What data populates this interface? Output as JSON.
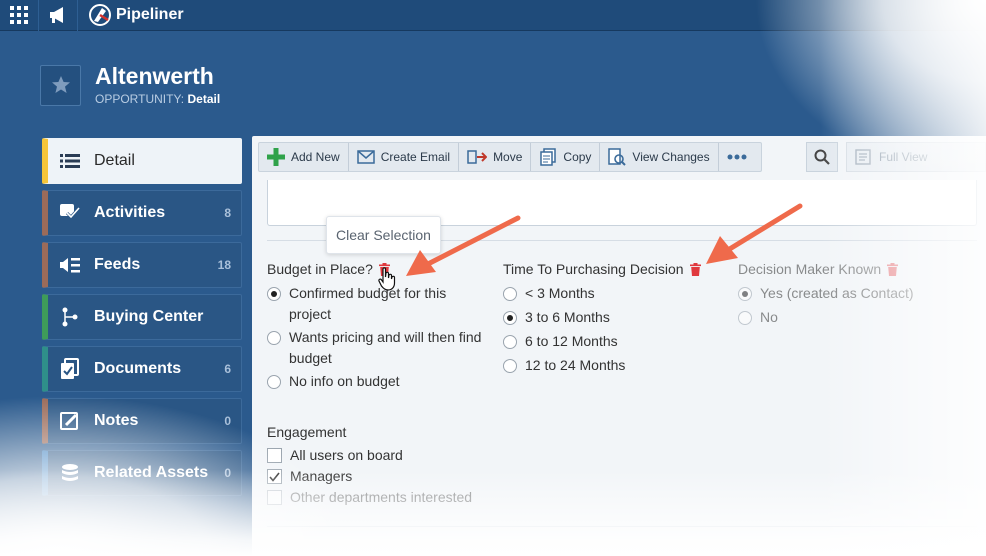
{
  "app": {
    "brand": "Pipeliner"
  },
  "header": {
    "title": "Altenwerth",
    "type_label": "OPPORTUNITY:",
    "view_label": "Detail"
  },
  "sidebar": {
    "items": [
      {
        "label": "Detail",
        "count": "",
        "accent": "#f5c53a"
      },
      {
        "label": "Activities",
        "count": "8",
        "accent": "#9b6b5a"
      },
      {
        "label": "Feeds",
        "count": "18",
        "accent": "#9b6b5a"
      },
      {
        "label": "Buying Center",
        "count": "",
        "accent": "#3e9b5a"
      },
      {
        "label": "Documents",
        "count": "6",
        "accent": "#2f8f8a"
      },
      {
        "label": "Notes",
        "count": "0",
        "accent": "#9b6b5a"
      },
      {
        "label": "Related Assets",
        "count": "0",
        "accent": "#3a7fc0"
      }
    ]
  },
  "toolbar": {
    "add_new": "Add New",
    "create_email": "Create Email",
    "move": "Move",
    "copy": "Copy",
    "view_changes": "View Changes",
    "full_view": "Full View"
  },
  "tooltip": {
    "text": "Clear Selection"
  },
  "fields": {
    "budget": {
      "label": "Budget in Place?",
      "options": [
        "Confirmed budget for this project",
        "Wants pricing and will then find budget",
        "No info on budget"
      ],
      "selected": 0
    },
    "time": {
      "label": "Time To Purchasing Decision",
      "options": [
        "< 3 Months",
        "3 to 6 Months",
        "6 to 12 Months",
        "12 to 24 Months"
      ],
      "selected": 1
    },
    "decision": {
      "label": "Decision Maker Known",
      "options": [
        "Yes (created as Contact)",
        "No"
      ],
      "selected": 0
    },
    "engagement": {
      "label": "Engagement",
      "options": [
        "All users on board",
        "Managers",
        "Other departments interested"
      ],
      "checked": [
        false,
        true,
        false
      ]
    }
  },
  "colors": {
    "accent_arrow": "#ef6a4b",
    "trash": "#e0393e",
    "nav_bg": "#2a5685"
  }
}
